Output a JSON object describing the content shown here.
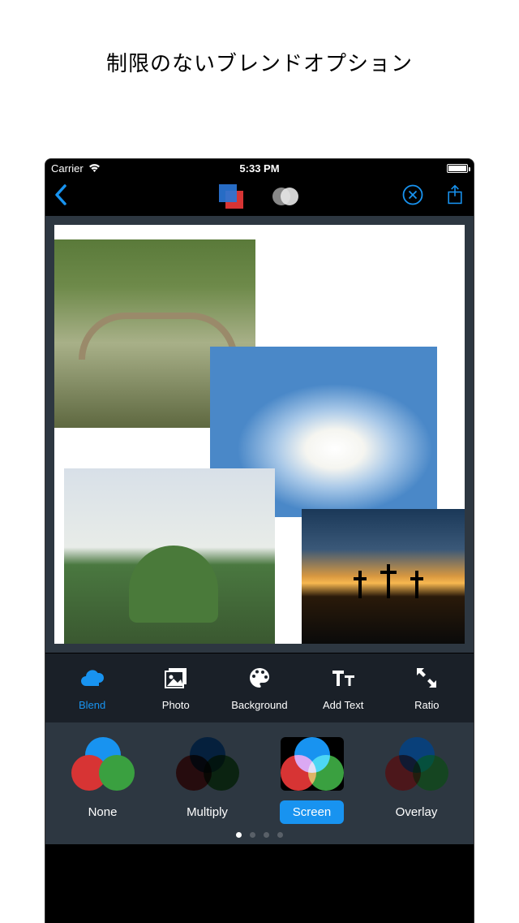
{
  "page": {
    "title": "制限のないブレンドオプション"
  },
  "statusbar": {
    "carrier": "Carrier",
    "time": "5:33 PM"
  },
  "toolbar": {
    "icons": {
      "back": "chevron-left",
      "logo": "blend-logo",
      "effect": "circles",
      "close": "close-circle",
      "share": "share"
    }
  },
  "tabs": [
    {
      "id": "blend",
      "label": "Blend",
      "icon": "cloud-icon",
      "active": true
    },
    {
      "id": "photo",
      "label": "Photo",
      "icon": "picture-icon",
      "active": false
    },
    {
      "id": "background",
      "label": "Background",
      "icon": "palette-icon",
      "active": false
    },
    {
      "id": "addtext",
      "label": "Add Text",
      "icon": "text-icon",
      "active": false
    },
    {
      "id": "ratio",
      "label": "Ratio",
      "icon": "expand-icon",
      "active": false
    }
  ],
  "blend_modes": [
    {
      "id": "none",
      "label": "None",
      "selected": false
    },
    {
      "id": "multiply",
      "label": "Multiply",
      "selected": false
    },
    {
      "id": "screen",
      "label": "Screen",
      "selected": true
    },
    {
      "id": "overlay",
      "label": "Overlay",
      "selected": false
    }
  ],
  "pagination": {
    "count": 4,
    "current": 0
  }
}
